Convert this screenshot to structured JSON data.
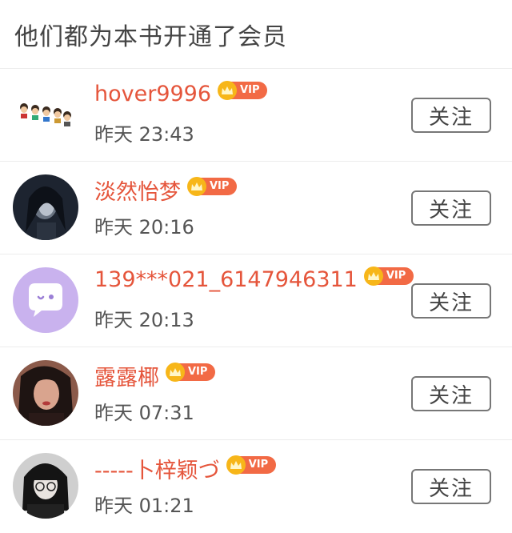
{
  "header": {
    "title": "他们都为本书开通了会员"
  },
  "members": [
    {
      "name": "hover9996",
      "badge": "VIP",
      "time": "昨天 23:43",
      "follow": "关注"
    },
    {
      "name": "淡然怡梦",
      "badge": "VIP",
      "time": "昨天 20:16",
      "follow": "关注"
    },
    {
      "name": "139***021_6147946311",
      "badge": "VIP",
      "time": "昨天 20:13",
      "follow": "关注"
    },
    {
      "name": "露露椰",
      "badge": "VIP",
      "time": "昨天 07:31",
      "follow": "关注"
    },
    {
      "name": "-----卜梓颖づ",
      "badge": "VIP",
      "time": "昨天 01:21",
      "follow": "关注"
    }
  ],
  "colors": {
    "name": "#e5553b",
    "vip": "#f26a45",
    "crown": "#f7b619"
  }
}
